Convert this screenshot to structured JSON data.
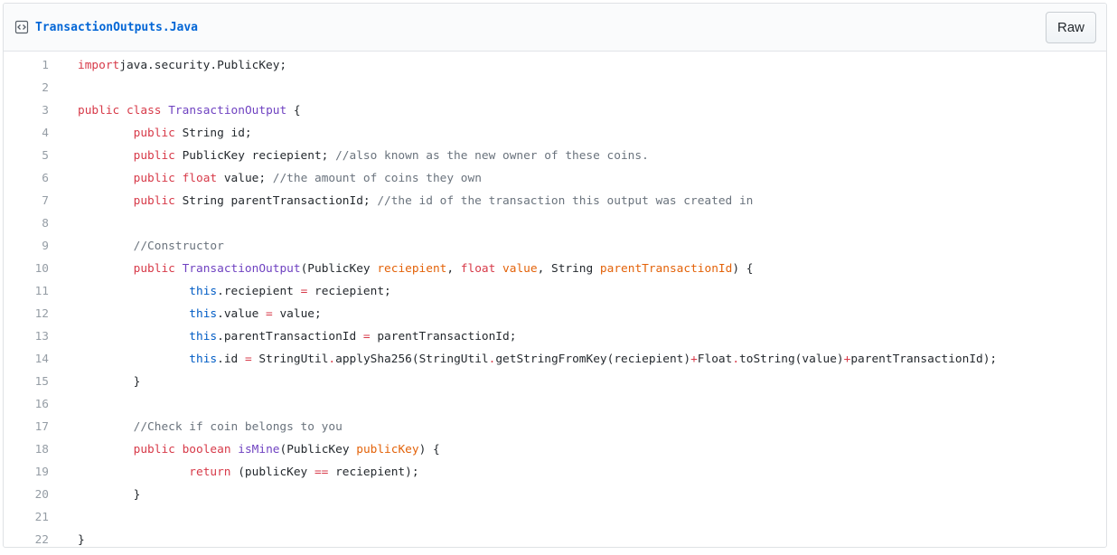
{
  "file": {
    "name": "TransactionOutputs.Java",
    "raw_label": "Raw",
    "icon": "code-file-icon"
  },
  "lines": [
    {
      "num": "1",
      "indent": "",
      "tokens": [
        [
          "k",
          "import"
        ],
        [
          "",
          "java.security.PublicKey;"
        ]
      ]
    },
    {
      "num": "2",
      "indent": "",
      "tokens": []
    },
    {
      "num": "3",
      "indent": "",
      "tokens": [
        [
          "k",
          "public"
        ],
        [
          "",
          " "
        ],
        [
          "k",
          "class"
        ],
        [
          "",
          " "
        ],
        [
          "t",
          "TransactionOutput"
        ],
        [
          "",
          " {"
        ]
      ]
    },
    {
      "num": "4",
      "indent": "        ",
      "tokens": [
        [
          "k",
          "public"
        ],
        [
          "",
          " String id;"
        ]
      ]
    },
    {
      "num": "5",
      "indent": "        ",
      "tokens": [
        [
          "k",
          "public"
        ],
        [
          "",
          " PublicKey reciepient; "
        ],
        [
          "c",
          "//also known as the new owner of these coins."
        ]
      ]
    },
    {
      "num": "6",
      "indent": "        ",
      "tokens": [
        [
          "k",
          "public"
        ],
        [
          "",
          " "
        ],
        [
          "k",
          "float"
        ],
        [
          "",
          " value; "
        ],
        [
          "c",
          "//the amount of coins they own"
        ]
      ]
    },
    {
      "num": "7",
      "indent": "        ",
      "tokens": [
        [
          "k",
          "public"
        ],
        [
          "",
          " String parentTransactionId; "
        ],
        [
          "c",
          "//the id of the transaction this output was created in"
        ]
      ]
    },
    {
      "num": "8",
      "indent": "",
      "tokens": []
    },
    {
      "num": "9",
      "indent": "        ",
      "tokens": [
        [
          "c",
          "//Constructor"
        ]
      ]
    },
    {
      "num": "10",
      "indent": "        ",
      "tokens": [
        [
          "k",
          "public"
        ],
        [
          "",
          " "
        ],
        [
          "t",
          "TransactionOutput"
        ],
        [
          "",
          "(PublicKey "
        ],
        [
          "v",
          "reciepient"
        ],
        [
          "",
          ", "
        ],
        [
          "k",
          "float"
        ],
        [
          "",
          " "
        ],
        [
          "v",
          "value"
        ],
        [
          "",
          ", String "
        ],
        [
          "v",
          "parentTransactionId"
        ],
        [
          "",
          ") {"
        ]
      ]
    },
    {
      "num": "11",
      "indent": "                ",
      "tokens": [
        [
          "s",
          "this"
        ],
        [
          "",
          ".reciepient "
        ],
        [
          "k",
          "="
        ],
        [
          "",
          " reciepient;"
        ]
      ]
    },
    {
      "num": "12",
      "indent": "                ",
      "tokens": [
        [
          "s",
          "this"
        ],
        [
          "",
          ".value "
        ],
        [
          "k",
          "="
        ],
        [
          "",
          " value;"
        ]
      ]
    },
    {
      "num": "13",
      "indent": "                ",
      "tokens": [
        [
          "s",
          "this"
        ],
        [
          "",
          ".parentTransactionId "
        ],
        [
          "k",
          "="
        ],
        [
          "",
          " parentTransactionId;"
        ]
      ]
    },
    {
      "num": "14",
      "indent": "                ",
      "tokens": [
        [
          "s",
          "this"
        ],
        [
          "",
          ".id "
        ],
        [
          "k",
          "="
        ],
        [
          "",
          " StringUtil"
        ],
        [
          "k",
          "."
        ],
        [
          "",
          "applySha256(StringUtil"
        ],
        [
          "k",
          "."
        ],
        [
          "",
          "getStringFromKey(reciepient)"
        ],
        [
          "k",
          "+"
        ],
        [
          "",
          "Float"
        ],
        [
          "k",
          "."
        ],
        [
          "",
          "toString(value)"
        ],
        [
          "k",
          "+"
        ],
        [
          "",
          "parentTransactionId);"
        ]
      ]
    },
    {
      "num": "15",
      "indent": "        ",
      "tokens": [
        [
          "",
          "}"
        ]
      ]
    },
    {
      "num": "16",
      "indent": "",
      "tokens": []
    },
    {
      "num": "17",
      "indent": "        ",
      "tokens": [
        [
          "c",
          "//Check if coin belongs to you"
        ]
      ]
    },
    {
      "num": "18",
      "indent": "        ",
      "tokens": [
        [
          "k",
          "public"
        ],
        [
          "",
          " "
        ],
        [
          "k",
          "boolean"
        ],
        [
          "",
          " "
        ],
        [
          "t",
          "isMine"
        ],
        [
          "",
          "(PublicKey "
        ],
        [
          "v",
          "publicKey"
        ],
        [
          "",
          ") {"
        ]
      ]
    },
    {
      "num": "19",
      "indent": "                ",
      "tokens": [
        [
          "k",
          "return"
        ],
        [
          "",
          " (publicKey "
        ],
        [
          "k",
          "=="
        ],
        [
          "",
          " reciepient);"
        ]
      ]
    },
    {
      "num": "20",
      "indent": "        ",
      "tokens": [
        [
          "",
          "}"
        ]
      ]
    },
    {
      "num": "21",
      "indent": "",
      "tokens": []
    },
    {
      "num": "22",
      "indent": "",
      "tokens": [
        [
          "",
          "}"
        ]
      ]
    }
  ]
}
